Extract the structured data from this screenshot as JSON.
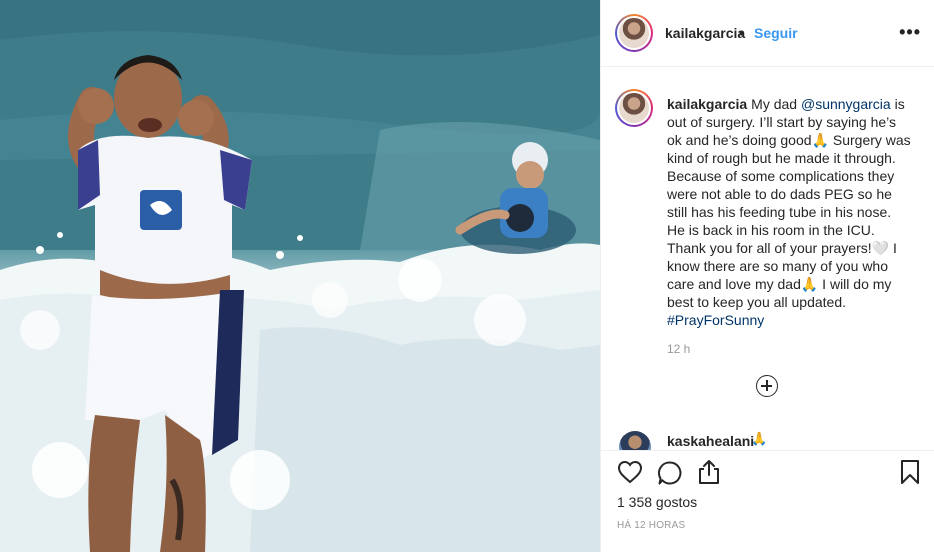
{
  "post": {
    "username": "kailakgarcia",
    "separator": "•",
    "follow_label": "Seguir",
    "more_icon": "more-options-icon"
  },
  "caption": {
    "username": "kailakgarcia",
    "text_1": "My dad ",
    "mention": "@sunnygarcia",
    "text_2": " is out of surgery. I’ll start by saying he’s ok and he’s doing good",
    "emoji_1": "🙏",
    "text_3": " Surgery was kind of rough but he made it through. Because of some complications they were not able to do dads PEG so he still has his feeding tube in his nose. He is back in his room in the ICU. Thank you for all of your prayers!",
    "emoji_2": "🤍",
    "text_4": " I know there are so many of you who care and love my dad",
    "emoji_3": "🙏",
    "text_5": " I will do my best to keep you all updated. ",
    "hashtag": "#PrayForSunny",
    "timestamp": "12 h"
  },
  "next_comment": {
    "username": "kaskahealani",
    "emoji": "🙏"
  },
  "actions": {
    "likes": "1 358 gostos",
    "time_ago": "HÁ 12 HORAS"
  },
  "colors": {
    "link": "#003569",
    "follow": "#3897f0",
    "muted": "#999999",
    "text": "#262626"
  }
}
